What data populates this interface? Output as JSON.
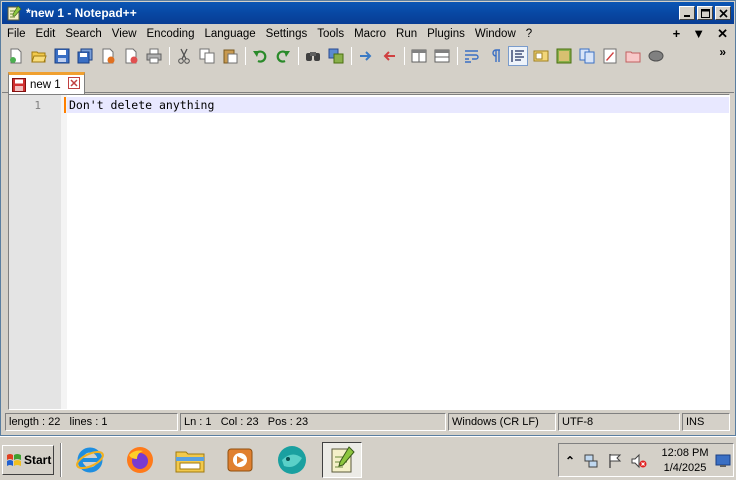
{
  "window": {
    "title": "*new 1 - Notepad++",
    "controls": {
      "minimize": "_",
      "maximize": "□",
      "close": "X"
    }
  },
  "menubar": {
    "items": [
      "File",
      "Edit",
      "Search",
      "View",
      "Encoding",
      "Language",
      "Settings",
      "Tools",
      "Macro",
      "Run",
      "Plugins",
      "Window",
      "?"
    ],
    "right": {
      "add": "+",
      "dropdown": "▼",
      "close": "✕"
    }
  },
  "toolbar": {
    "icons": [
      "new-file-icon",
      "open-file-icon",
      "save-icon",
      "save-all-icon",
      "close-icon",
      "close-all-icon",
      "print-icon",
      "cut-icon",
      "copy-icon",
      "paste-icon",
      "undo-icon",
      "redo-icon",
      "find-icon",
      "replace-icon",
      "zoom-in-icon",
      "zoom-out-icon",
      "sync-vertical-icon",
      "sync-horizontal-icon",
      "word-wrap-icon",
      "show-all-characters-icon",
      "indent-guide-icon",
      "user-defined-language-icon",
      "document-map-icon",
      "function-list-icon",
      "folder-as-workspace-icon",
      "monitoring-icon",
      "macro-record-icon"
    ],
    "more": "»"
  },
  "tabs": [
    {
      "label": "new 1",
      "active": true,
      "close": "⊠"
    }
  ],
  "editor": {
    "line_numbers": [
      "1"
    ],
    "lines": [
      "Don't delete anything"
    ],
    "current_line_color": "#e8e8ff",
    "caret_color": "#ff8000"
  },
  "statusbar": {
    "length": "length : 22",
    "lines": "lines : 1",
    "ln": "Ln : 1",
    "col": "Col : 23",
    "pos": "Pos : 23",
    "eol": "Windows (CR LF)",
    "encoding": "UTF-8",
    "mode": "INS"
  },
  "taskbar": {
    "start_label": "Start",
    "apps": [
      "internet-explorer-icon",
      "firefox-icon",
      "file-explorer-icon",
      "media-player-icon",
      "chat-app-icon",
      "notepad-plus-plus-icon"
    ],
    "tray": {
      "expand": "⌃",
      "time": "12:08 PM",
      "date": "1/4/2025"
    }
  }
}
